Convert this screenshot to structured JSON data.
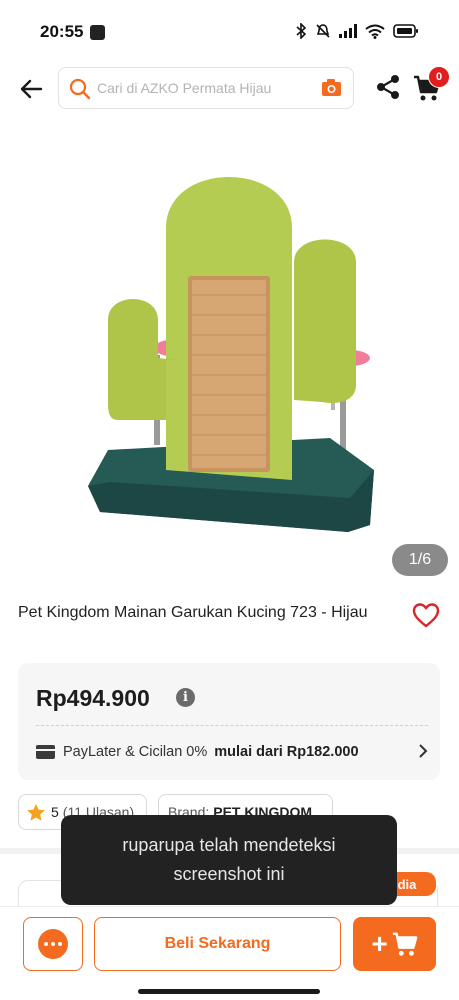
{
  "status_bar": {
    "time": "20:55"
  },
  "header": {
    "search_placeholder": "Cari di AZKO Permata Hijau",
    "cart_count": "0",
    "icons": [
      "back-arrow-icon",
      "search-icon",
      "camera-icon",
      "share-icon",
      "cart-icon"
    ]
  },
  "gallery": {
    "counter": "1/6"
  },
  "product": {
    "title": "Pet Kingdom Mainan Garukan Kucing 723 - Hijau",
    "price": "Rp494.900",
    "paylater_label": "PayLater & Cicilan 0%",
    "paylater_value": "mulai dari Rp182.000",
    "rating": "5",
    "reviews": "(11 Ulasan)",
    "brand_label": "Brand:",
    "brand_value": "PET KINGDOM"
  },
  "promo": {
    "tag": "dia"
  },
  "toast": {
    "message": "ruparupa telah mendeteksi screenshot ini"
  },
  "bottom_bar": {
    "buy_label": "Beli Sekarang",
    "add_to_cart_label": "+"
  },
  "colors": {
    "accent": "#f46a1f",
    "badge": "#e21d1d",
    "toast_bg": "#222223"
  }
}
